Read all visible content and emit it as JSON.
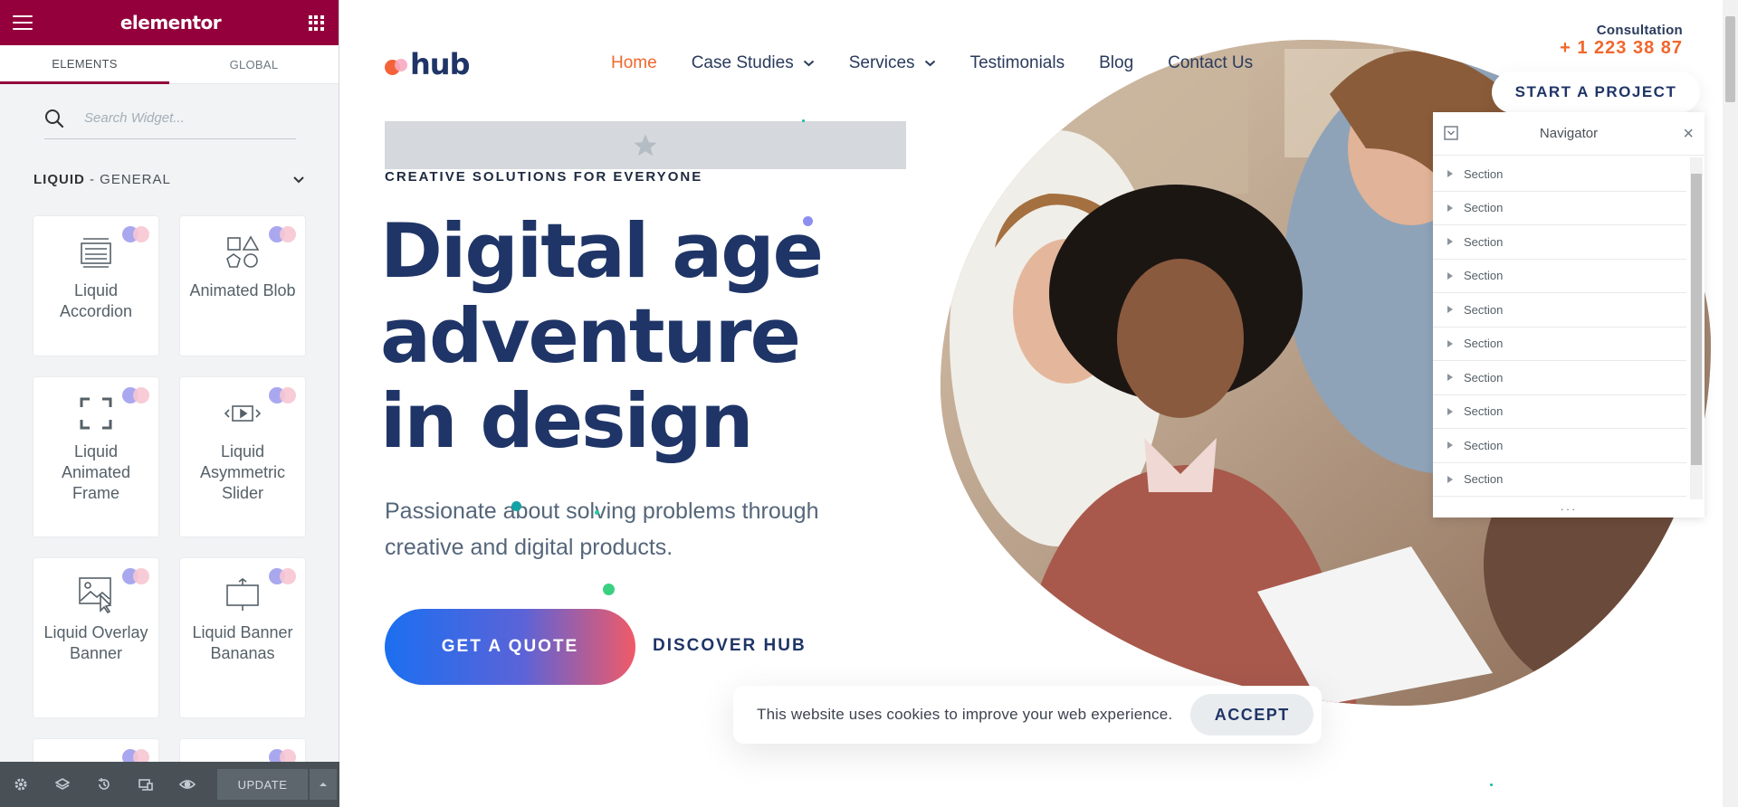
{
  "editor": {
    "brand": "elementor",
    "tabs": [
      "ELEMENTS",
      "GLOBAL"
    ],
    "search": {
      "placeholder": "Search Widget..."
    },
    "category": {
      "bold": "LIQUID",
      "rest": " - GENERAL"
    },
    "widgets": [
      {
        "label": "Liquid Accordion",
        "icon": "accordion-icon"
      },
      {
        "label": "Animated Blob",
        "icon": "shapes-icon"
      },
      {
        "label": "Liquid Animated Frame",
        "icon": "frame-icon"
      },
      {
        "label": "Liquid Asymmetric Slider",
        "icon": "slider-icon"
      },
      {
        "label": "Liquid Overlay Banner",
        "icon": "image-cursor-icon"
      },
      {
        "label": "Liquid Banner Bananas",
        "icon": "banner-icon"
      }
    ],
    "footer": {
      "update_label": "UPDATE"
    }
  },
  "site": {
    "logo_text": "hub",
    "nav": [
      {
        "label": "Home",
        "active": true,
        "dropdown": false
      },
      {
        "label": "Case Studies",
        "active": false,
        "dropdown": true
      },
      {
        "label": "Services",
        "active": false,
        "dropdown": true
      },
      {
        "label": "Testimonials",
        "active": false,
        "dropdown": false
      },
      {
        "label": "Blog",
        "active": false,
        "dropdown": false
      },
      {
        "label": "Contact Us",
        "active": false,
        "dropdown": false
      }
    ],
    "consultation": {
      "label": "Consultation",
      "phone": "+ 1 223 38 87"
    },
    "start_button": "START A PROJECT",
    "eyebrow": "CREATIVE SOLUTIONS FOR EVERYONE",
    "headline": [
      "Digital age",
      "adventure",
      "in design"
    ],
    "subtext": "Passionate about solving problems through creative and digital products.",
    "quote_button": "GET A QUOTE",
    "discover_link": "DISCOVER HUB",
    "cookie": {
      "text": "This website uses cookies to improve your web experience.",
      "accept": "ACCEPT"
    }
  },
  "navigator": {
    "title": "Navigator",
    "rows": [
      "Section",
      "Section",
      "Section",
      "Section",
      "Section",
      "Section",
      "Section",
      "Section",
      "Section",
      "Section"
    ]
  },
  "colors": {
    "editor_brand": "#93003c",
    "accent_orange": "#f0672c",
    "heading_navy": "#1f3567",
    "gradient_start": "#1b6ff0",
    "gradient_end": "#f05a68"
  }
}
